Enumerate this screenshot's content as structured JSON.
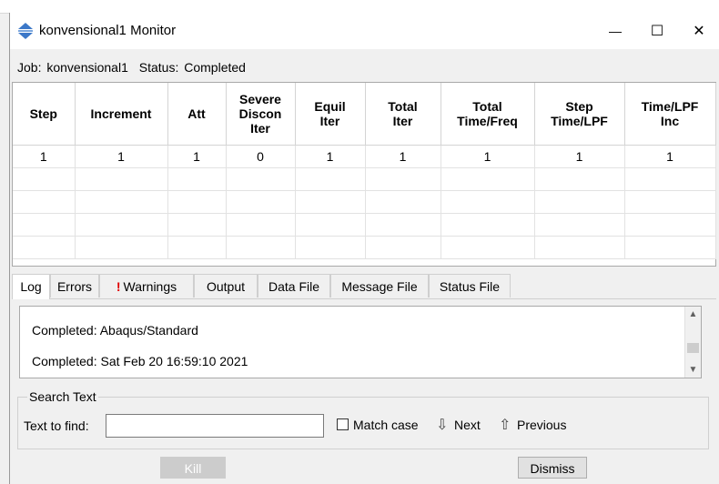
{
  "window": {
    "title": "konvensional1 Monitor",
    "minimize_glyph": "—",
    "maximize_glyph": "☐",
    "close_glyph": "✕"
  },
  "job": {
    "job_label": "Job:",
    "job_name": "konvensional1",
    "status_label": "Status:",
    "status_value": "Completed"
  },
  "table": {
    "headers": [
      [
        "Step"
      ],
      [
        "Increment"
      ],
      [
        "Att"
      ],
      [
        "Severe",
        "Discon",
        "Iter"
      ],
      [
        "Equil",
        "Iter"
      ],
      [
        "Total",
        "Iter"
      ],
      [
        "Total",
        "Time/Freq"
      ],
      [
        "Step",
        "Time/LPF"
      ],
      [
        "Time/LPF",
        "Inc"
      ]
    ],
    "rows": [
      [
        "1",
        "1",
        "1",
        "0",
        "1",
        "1",
        "1",
        "1",
        "1"
      ],
      [
        "",
        "",
        "",
        "",
        "",
        "",
        "",
        "",
        ""
      ],
      [
        "",
        "",
        "",
        "",
        "",
        "",
        "",
        "",
        ""
      ],
      [
        "",
        "",
        "",
        "",
        "",
        "",
        "",
        "",
        ""
      ],
      [
        "",
        "",
        "",
        "",
        "",
        "",
        "",
        "",
        ""
      ]
    ]
  },
  "tabs": {
    "log": "Log",
    "errors": "Errors",
    "warnings_mark": "!",
    "warnings": "Warnings",
    "output": "Output",
    "data_file": "Data File",
    "message_file": "Message File",
    "status_file": "Status File",
    "active": "log"
  },
  "log": {
    "lines": [
      "Completed: Abaqus/Standard",
      "Completed: Sat Feb 20 16:59:10 2021"
    ],
    "scroll_up_glyph": "▲",
    "scroll_down_glyph": "▼"
  },
  "search": {
    "group_label": "Search Text",
    "find_label": "Text to find:",
    "find_value": "",
    "match_case_label": "Match case",
    "match_case_checked": false,
    "next_glyph": "⇩",
    "next_label": "Next",
    "previous_glyph": "⇧",
    "previous_label": "Previous"
  },
  "buttons": {
    "kill": "Kill",
    "dismiss": "Dismiss"
  },
  "colors": {
    "warning_mark": "#e00000",
    "app_icon": "#3c78c8",
    "disabled_button": "#cccccc"
  },
  "icons": {
    "app": "abaqus-monitor-icon",
    "next": "arrow-down-icon",
    "previous": "arrow-up-icon"
  }
}
